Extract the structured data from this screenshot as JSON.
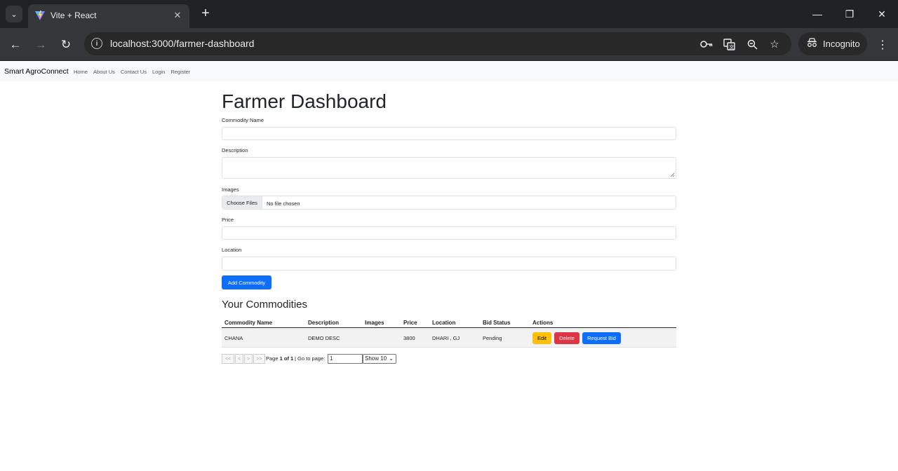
{
  "browser": {
    "tab_title": "Vite + React",
    "url_host": "localhost",
    "url_rest": ":3000/farmer-dashboard",
    "incognito_label": "Incognito"
  },
  "navbar": {
    "brand": "Smart AgroConnect",
    "links": [
      "Home",
      "About Us",
      "Contact Us",
      "Login",
      "Register"
    ]
  },
  "form": {
    "title": "Farmer Dashboard",
    "commodity_name_label": "Commodity Name",
    "description_label": "Description",
    "images_label": "Images",
    "choose_files": "Choose Files",
    "no_file": "No file chosen",
    "price_label": "Price",
    "location_label": "Location",
    "submit": "Add Commodity"
  },
  "commodities": {
    "heading": "Your Commodities",
    "columns": [
      "Commodity Name",
      "Description",
      "Images",
      "Price",
      "Location",
      "Bid Status",
      "Actions"
    ],
    "rows": [
      {
        "name": "CHANA",
        "description": "DEMO DESC",
        "images": "",
        "price": "3800",
        "location": "DHARI , GJ",
        "bid_status": "Pending"
      }
    ],
    "actions": {
      "edit": "Edit",
      "delete": "Delete",
      "request_bid": "Request Bid"
    }
  },
  "pagination": {
    "first": "<<",
    "prev": "<",
    "next": ">",
    "last": ">>",
    "page_prefix": "Page",
    "page_current": "1 of 1",
    "goto_label": "| Go to page:",
    "goto_value": "1",
    "page_size": "Show 10"
  }
}
